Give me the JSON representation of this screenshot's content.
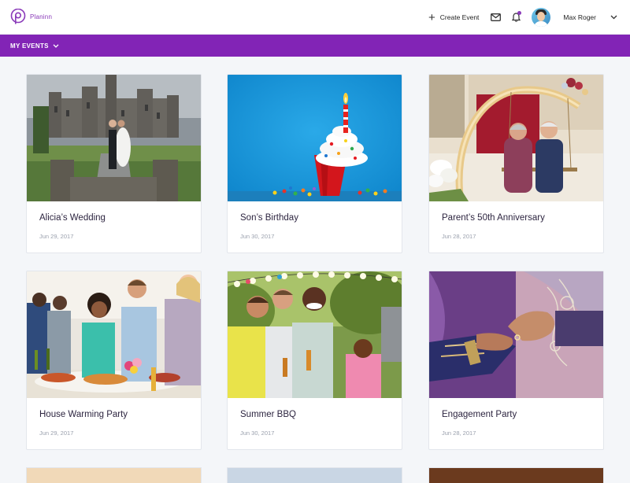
{
  "app": {
    "brand": "Planinn",
    "accent_color": "#8224b6"
  },
  "header": {
    "create_event_label": "Create Event",
    "user_name": "Max Roger",
    "icons": [
      "plus-icon",
      "mail-icon",
      "bell-icon",
      "chevron-down-icon"
    ]
  },
  "subnav": {
    "my_events_label": "MY EVENTS"
  },
  "events": [
    {
      "title": "Alicia’s Wedding",
      "date": "Jun 29, 2017",
      "image": "castle-wedding-photo"
    },
    {
      "title": "Son’s Birthday",
      "date": "Jun 30, 2017",
      "image": "birthday-cupcake-photo"
    },
    {
      "title": "Parent’s 50th Anniversary",
      "date": "Jun 28, 2017",
      "image": "elderly-couple-figurine-photo"
    },
    {
      "title": "House Warming Party",
      "date": "Jun 29, 2017",
      "image": "kitchen-party-photo"
    },
    {
      "title": "Summer BBQ",
      "date": "Jun 30, 2017",
      "image": "outdoor-bbq-photo"
    },
    {
      "title": "Engagement Party",
      "date": "Jun 28, 2017",
      "image": "ring-exchange-photo"
    }
  ]
}
